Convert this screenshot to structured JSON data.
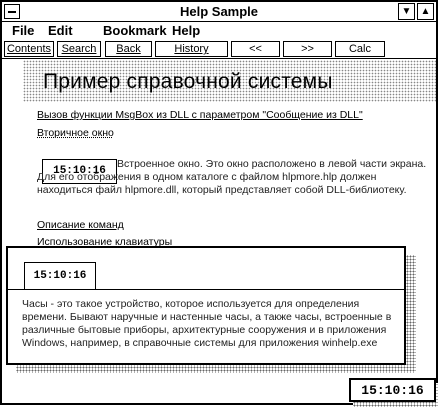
{
  "window": {
    "title": "Help Sample",
    "minimize_glyph": "▼",
    "maximize_glyph": "▲"
  },
  "menu": [
    "File",
    "Edit",
    "Bookmark",
    "Help"
  ],
  "tabs": [
    "Contents",
    "Search",
    "Back",
    "History",
    "<<",
    ">>",
    "Calc"
  ],
  "heading": "Пример справочной системы",
  "links": {
    "dll_call": "Вызов функции MsgBox из DLL с параметром \"Сообщение из DLL\"",
    "secondary_window": "Вторичное окно",
    "commands": "Описание команд",
    "keyboard": "Использование клавиатуры"
  },
  "embedded_clock": "15:10:16",
  "embedded_text": "Встроенное окно. Это окно расположено в левой части экрана. Для его отображения в одном каталоге с файлом hlpmore.hlp должен находиться файл hlpmore.dll, который представляет собой DLL-библиотеку.",
  "popup": {
    "clock": "15:10:16",
    "text": "Часы - это такое устройство, которое используется для определения времени. Бывают наручные и настенные часы, а также часы, встроенные в различные бытовые приборы, архитектурные сооружения и в приложения Windows, например, в справочные системы для приложения winhelp.exe"
  },
  "bottom_clock": "15:10:16"
}
